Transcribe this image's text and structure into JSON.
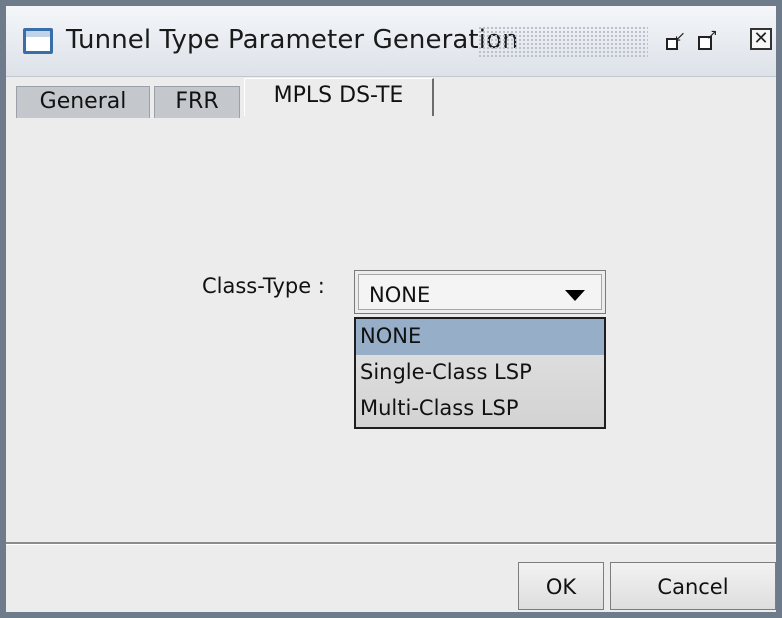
{
  "window": {
    "title": "Tunnel Type Parameter Generation",
    "controls": {
      "iconify": "⇱",
      "maximize": "⇲",
      "close": "✕"
    }
  },
  "tabs": [
    {
      "label": "General",
      "active": false
    },
    {
      "label": "FRR",
      "active": false
    },
    {
      "label": "MPLS DS-TE",
      "active": true
    }
  ],
  "form": {
    "class_type_label": "Class-Type :",
    "class_type_value": "NONE",
    "options": [
      {
        "label": "NONE",
        "selected": true
      },
      {
        "label": "Single-Class LSP",
        "selected": false
      },
      {
        "label": "Multi-Class LSP",
        "selected": false
      }
    ]
  },
  "buttons": {
    "ok": "OK",
    "cancel": "Cancel"
  },
  "colors": {
    "selection": "#96aec7",
    "window_border": "#6d7b8a",
    "panel": "#ececec"
  }
}
